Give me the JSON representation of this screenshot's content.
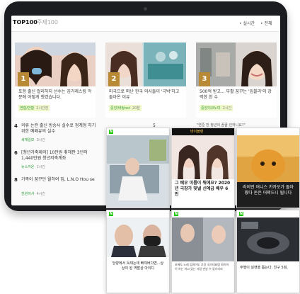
{
  "tabs": {
    "top100": "TOP100",
    "other": "주제100"
  },
  "dropdowns": {
    "realtime": "• 실시간",
    "all": "• 전체"
  },
  "cards": [
    {
      "rank": "1",
      "title": "포항 출신 컬리하지 선수는 김거레스링 악분에 어떻게 했겠습니다.",
      "source": "연합/반합",
      "time": "· 2시간전"
    },
    {
      "rank": "2",
      "title": "미국으로 떠난 한국 의사들이 '극박'하고 돌아온 이유",
      "source": "중앙/바탕ost",
      "time": "· 20분"
    },
    {
      "rank": "3",
      "title": "500억 받고... 부활 꿈꾸는 '임블리'의 강력한 한 수",
      "source": "중앙이코노미",
      "time": "· 2시간"
    }
  ],
  "list": [
    {
      "num": "4",
      "title": "의류 논란 출신 방송사 실수로 정계형 하기 위한 예배유의 실수",
      "source": "세계일보",
      "time": "· 3시간"
    },
    {
      "num": "6",
      "title": "[청년가축제의] 10만원 취해판 3년의 1,440만원 청년저축계좌",
      "source": "뉴스카운",
      "time": "· 1시간"
    },
    {
      "num": "8",
      "title": "가족이 꿈꾸던 월하여 집, L.N.O Hou se",
      "source": "전원의사",
      "time": "· 4시간"
    }
  ],
  "phones": [
    {
      "caption": "",
      "logo": "N"
    },
    {
      "caption": "그 배우 이름이 뭐에요? 2020년 극장가 빛낼 신예급 배우 6인",
      "header": "바이블랜"
    },
    {
      "caption": "라이언 어니스 카카오가 돌아왔다 돈은 어쩌드니 됩니다"
    },
    {
      "caption": "당양에서 득재는데 빠져버다면...상상이 된 역발상 아이디",
      "logo": "N"
    },
    {
      "caption": "포에도 노래 임파이도 기강 국가대표팀 파이어 이 하는 하고 있는 사람 만날 수 있으리라",
      "logo": "N"
    },
    {
      "caption": "주행이 실현을 돕는다. 친구 5점.",
      "logo": "N"
    }
  ],
  "snippets": {
    "hanging": "\"연준 만 청년이 꿈꿀 인하니요?\"",
    "num5": "5"
  }
}
